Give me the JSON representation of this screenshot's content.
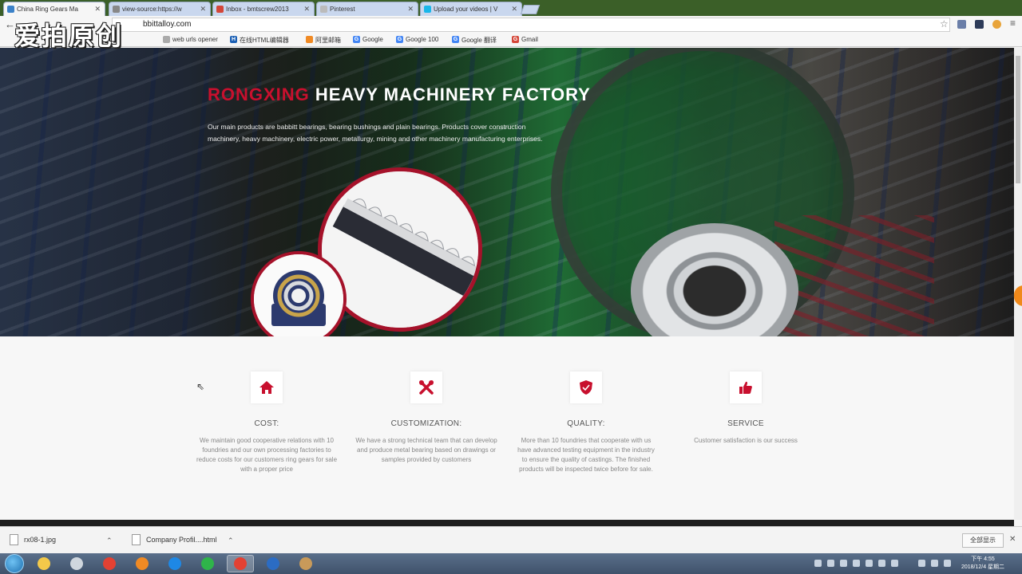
{
  "browser": {
    "tabs": [
      {
        "title": "China Ring Gears Ma",
        "favicon_color": "#3c82c8",
        "active": true
      },
      {
        "title": "view-source:https://w",
        "favicon_color": "#888888",
        "active": false
      },
      {
        "title": "Inbox - bmtscrew2013",
        "favicon_color": "#d44638",
        "active": false
      },
      {
        "title": "Pinterest",
        "favicon_color": "#bbbbbb",
        "active": false
      },
      {
        "title": "Upload your videos | V",
        "favicon_color": "#1ab7ea",
        "active": false
      }
    ],
    "url": "bbittalloy.com",
    "bookmarks": [
      {
        "label": "web urls opener",
        "icon_color": "#aaaaaa",
        "icon_char": ""
      },
      {
        "label": "在线HTML编辑器",
        "icon_color": "#1a5fb4",
        "icon_char": "H"
      },
      {
        "label": "阿里邮箱",
        "icon_color": "#f08a24",
        "icon_char": ""
      },
      {
        "label": "Google",
        "icon_color": "#4285f4",
        "icon_char": "G"
      },
      {
        "label": "Google 100",
        "icon_color": "#4285f4",
        "icon_char": "G"
      },
      {
        "label": "Google 翻译",
        "icon_color": "#4285f4",
        "icon_char": "G"
      },
      {
        "label": "Gmail",
        "icon_color": "#d44638",
        "icon_char": "G"
      }
    ],
    "watermark": "爱拍原创"
  },
  "hero": {
    "title_accent": "RONGXING",
    "title_main": "HEAVY MACHINERY FACTORY",
    "description": "Our main products are babbitt bearings, bearing bushings and plain bearings. Products cover construction machinery, heavy machinery, electric power, metallurgy, mining and other machinery manufacturing enterprises.",
    "slide_count": 2,
    "active_slide": 2,
    "accent_color": "#c8102e"
  },
  "features": [
    {
      "icon": "home-icon",
      "title": "COST:",
      "text": "We maintain good cooperative relations with 10 foundries and our own processing factories to reduce costs for our customers ring gears for sale with a proper price"
    },
    {
      "icon": "tools-icon",
      "title": "CUSTOMIZATION:",
      "text": "We have a strong technical team that can develop and produce metal bearing based on drawings or samples provided by customers"
    },
    {
      "icon": "shield-icon",
      "title": "QUALITY:",
      "text": "More than 10 foundries that cooperate with us have advanced testing equipment in the industry to ensure the quality of castings. The finished products will be inspected twice before for sale."
    },
    {
      "icon": "thumbs-up-icon",
      "title": "SERVICE",
      "text": "Customer satisfaction is our success"
    }
  ],
  "downloads": {
    "items": [
      {
        "name": "rx08-1.jpg"
      },
      {
        "name": "Company Profil....html"
      }
    ],
    "show_all_label": "全部显示"
  },
  "taskbar": {
    "apps": [
      {
        "name": "explorer",
        "color": "#f3c94a",
        "active": false
      },
      {
        "name": "device",
        "color": "#cfd6de",
        "active": false
      },
      {
        "name": "chrome",
        "color": "#e34133",
        "active": false
      },
      {
        "name": "firefox",
        "color": "#f08a24",
        "active": false
      },
      {
        "name": "app-s",
        "color": "#1e88e5",
        "active": false
      },
      {
        "name": "app-green",
        "color": "#2fb44a",
        "active": false
      },
      {
        "name": "chrome-active",
        "color": "#e34133",
        "active": true
      },
      {
        "name": "word",
        "color": "#2b6cc4",
        "active": false
      },
      {
        "name": "media",
        "color": "#c89a5a",
        "active": false
      }
    ],
    "clock_time": "下午 4:55",
    "clock_date": "2018/12/4 星期二"
  }
}
